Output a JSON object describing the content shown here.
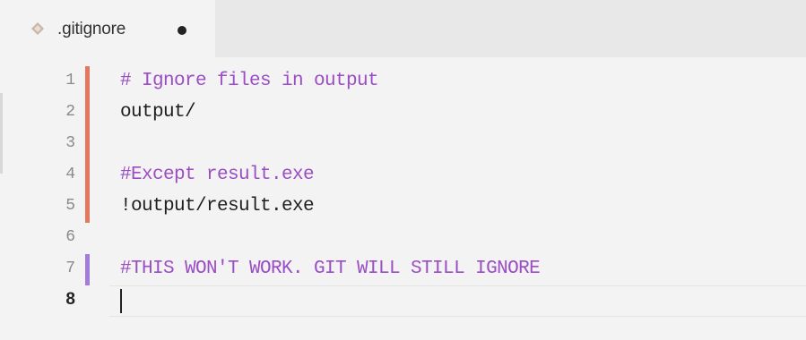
{
  "tab": {
    "title": ".gitignore",
    "icon": "diamond-file-icon",
    "modified": true
  },
  "colors": {
    "modified_marker": "#e2795c",
    "added_marker": "#a27bdb",
    "comment": "#9b4dc5",
    "text": "#1e1e1e"
  },
  "editor": {
    "active_line": 8,
    "lines": [
      {
        "number": "1",
        "text": "# Ignore files in output",
        "kind": "comment",
        "marker": "modified"
      },
      {
        "number": "2",
        "text": "output/",
        "kind": "plain",
        "marker": "modified"
      },
      {
        "number": "3",
        "text": "",
        "kind": "plain",
        "marker": "modified"
      },
      {
        "number": "4",
        "text": "#Except result.exe",
        "kind": "comment",
        "marker": "modified"
      },
      {
        "number": "5",
        "text": "!output/result.exe",
        "kind": "plain",
        "marker": "modified"
      },
      {
        "number": "6",
        "text": "",
        "kind": "plain",
        "marker": "none"
      },
      {
        "number": "7",
        "text": "#THIS WON'T WORK. GIT WILL STILL IGNORE",
        "kind": "comment",
        "marker": "added"
      },
      {
        "number": "8",
        "text": "",
        "kind": "plain",
        "marker": "none"
      }
    ]
  }
}
